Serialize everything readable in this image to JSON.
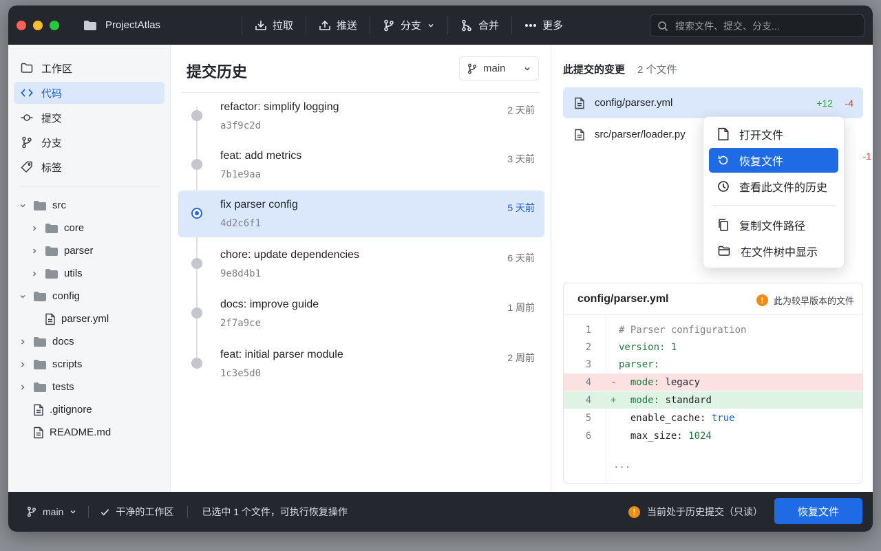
{
  "titlebar": {
    "project": "ProjectAtlas",
    "pull": "拉取",
    "push": "推送",
    "branch": "分支",
    "merge": "合并",
    "more": "更多",
    "search_placeholder": "搜索文件、提交、分支..."
  },
  "sidebar": {
    "nav": [
      {
        "label": "工作区",
        "icon": "folder-icon"
      },
      {
        "label": "代码",
        "icon": "code-icon"
      },
      {
        "label": "提交",
        "icon": "commit-icon"
      },
      {
        "label": "分支",
        "icon": "branch-icon"
      },
      {
        "label": "标签",
        "icon": "tag-icon"
      }
    ],
    "tree": [
      {
        "label": "src"
      },
      {
        "label": "core"
      },
      {
        "label": "parser"
      },
      {
        "label": "utils"
      },
      {
        "label": "config"
      },
      {
        "label": "parser.yml"
      },
      {
        "label": "docs"
      },
      {
        "label": "scripts"
      },
      {
        "label": "tests"
      },
      {
        "label": ".gitignore"
      },
      {
        "label": "README.md"
      }
    ]
  },
  "commits": {
    "title": "提交历史",
    "branch": "main",
    "items": [
      {
        "message": "refactor: simplify logging",
        "hash": "a3f9c2d",
        "time": "2 天前"
      },
      {
        "message": "feat: add metrics",
        "hash": "7b1e9aa",
        "time": "3 天前"
      },
      {
        "message": "fix parser config",
        "hash": "4d2c6f1",
        "time": "5 天前"
      },
      {
        "message": "chore: update dependencies",
        "hash": "9e8d4b1",
        "time": "6 天前"
      },
      {
        "message": "docs: improve guide",
        "hash": "2f7a9ce",
        "time": "1 周前"
      },
      {
        "message": "feat: initial parser module",
        "hash": "1c3e5d0",
        "time": "2 周前"
      }
    ]
  },
  "changes": {
    "title": "此提交的变更",
    "count": "2 个文件",
    "files": [
      {
        "name": "config/parser.yml",
        "added": "+12",
        "removed": "-4"
      },
      {
        "name": "src/parser/loader.py",
        "removed": "-1"
      }
    ]
  },
  "context_menu": {
    "items": [
      {
        "label": "打开文件"
      },
      {
        "label": "恢复文件"
      },
      {
        "label": "查看此文件的历史"
      },
      {
        "label": "复制文件路径"
      },
      {
        "label": "在文件树中显示"
      }
    ]
  },
  "viewer": {
    "filename": "config/parser.yml",
    "note": "此为较早版本的文件",
    "lines": [
      {
        "num": "1",
        "text": "# Parser configuration"
      },
      {
        "num": "2",
        "key": "version:",
        "value": " 1"
      },
      {
        "num": "3",
        "key": "parser:",
        "value": ""
      },
      {
        "num": "4",
        "mark": "-",
        "key": "  mode:",
        "value": " legacy"
      },
      {
        "num": "4",
        "mark": "+",
        "key": "  mode:",
        "value": " standard"
      },
      {
        "num": "5",
        "key": "  enable_cache:",
        "value": " true"
      },
      {
        "num": "6",
        "key": "  max_size:",
        "value": " 1024"
      }
    ],
    "ellipsis": "..."
  },
  "statusbar": {
    "branch": "main",
    "clean": "干净的工作区",
    "selection": "已选中 1 个文件，可执行恢复操作",
    "history_note": "当前处于历史提交（只读）",
    "restore_button": "恢复文件"
  },
  "colors": {
    "accent": "#1f6be6",
    "added": "#2ea043",
    "removed": "#d93838",
    "warning": "#f08c12"
  }
}
